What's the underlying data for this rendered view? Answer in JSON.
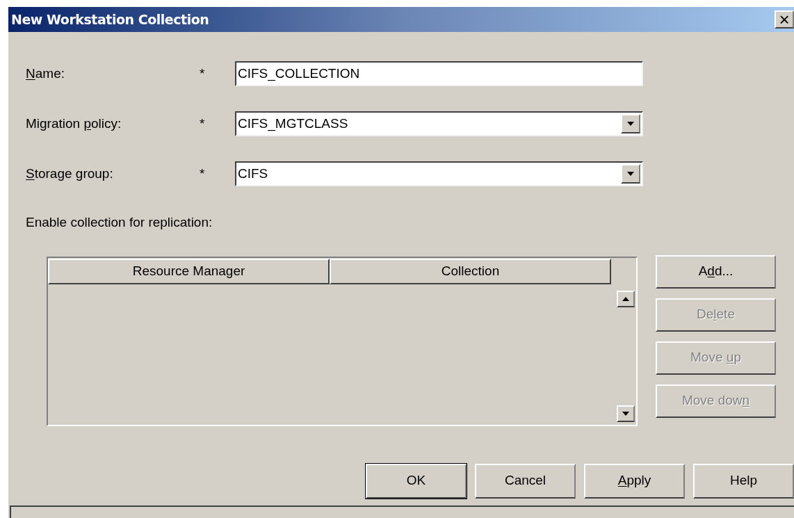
{
  "window": {
    "title": "New Workstation Collection",
    "close": "×"
  },
  "fields": [
    {
      "kind": "text",
      "label": {
        "key": "N",
        "after": "ame:"
      },
      "required": "*",
      "value": "CIFS_COLLECTION"
    },
    {
      "kind": "dropdown",
      "label": {
        "before": "Migration ",
        "key": "p",
        "after": "olicy:"
      },
      "required": "*",
      "value": "CIFS_MGTCLASS"
    },
    {
      "kind": "dropdown",
      "label": {
        "key": "S",
        "after": "torage group:"
      },
      "required": "*",
      "value": "CIFS"
    }
  ],
  "replication": {
    "label": "Enable collection for replication:",
    "table": {
      "columns": [
        "Resource Manager",
        "Collection"
      ]
    },
    "buttons": [
      {
        "label": {
          "before": "A",
          "key": "d",
          "after": "d..."
        },
        "disabled": false
      },
      {
        "label": {
          "before": "De",
          "key": "l",
          "after": "ete"
        },
        "disabled": true
      },
      {
        "label": {
          "before": "Move ",
          "key": "u",
          "after": "p"
        },
        "disabled": true
      },
      {
        "label": {
          "before": "Move dow",
          "key": "n"
        },
        "disabled": true
      }
    ]
  },
  "buttons": [
    {
      "label": {
        "before": "OK"
      },
      "default": true
    },
    {
      "label": {
        "before": "Cancel"
      },
      "default": false
    },
    {
      "label": {
        "key": "A",
        "after": "pply"
      },
      "default": false
    },
    {
      "label": {
        "before": "Help"
      },
      "default": false
    }
  ]
}
